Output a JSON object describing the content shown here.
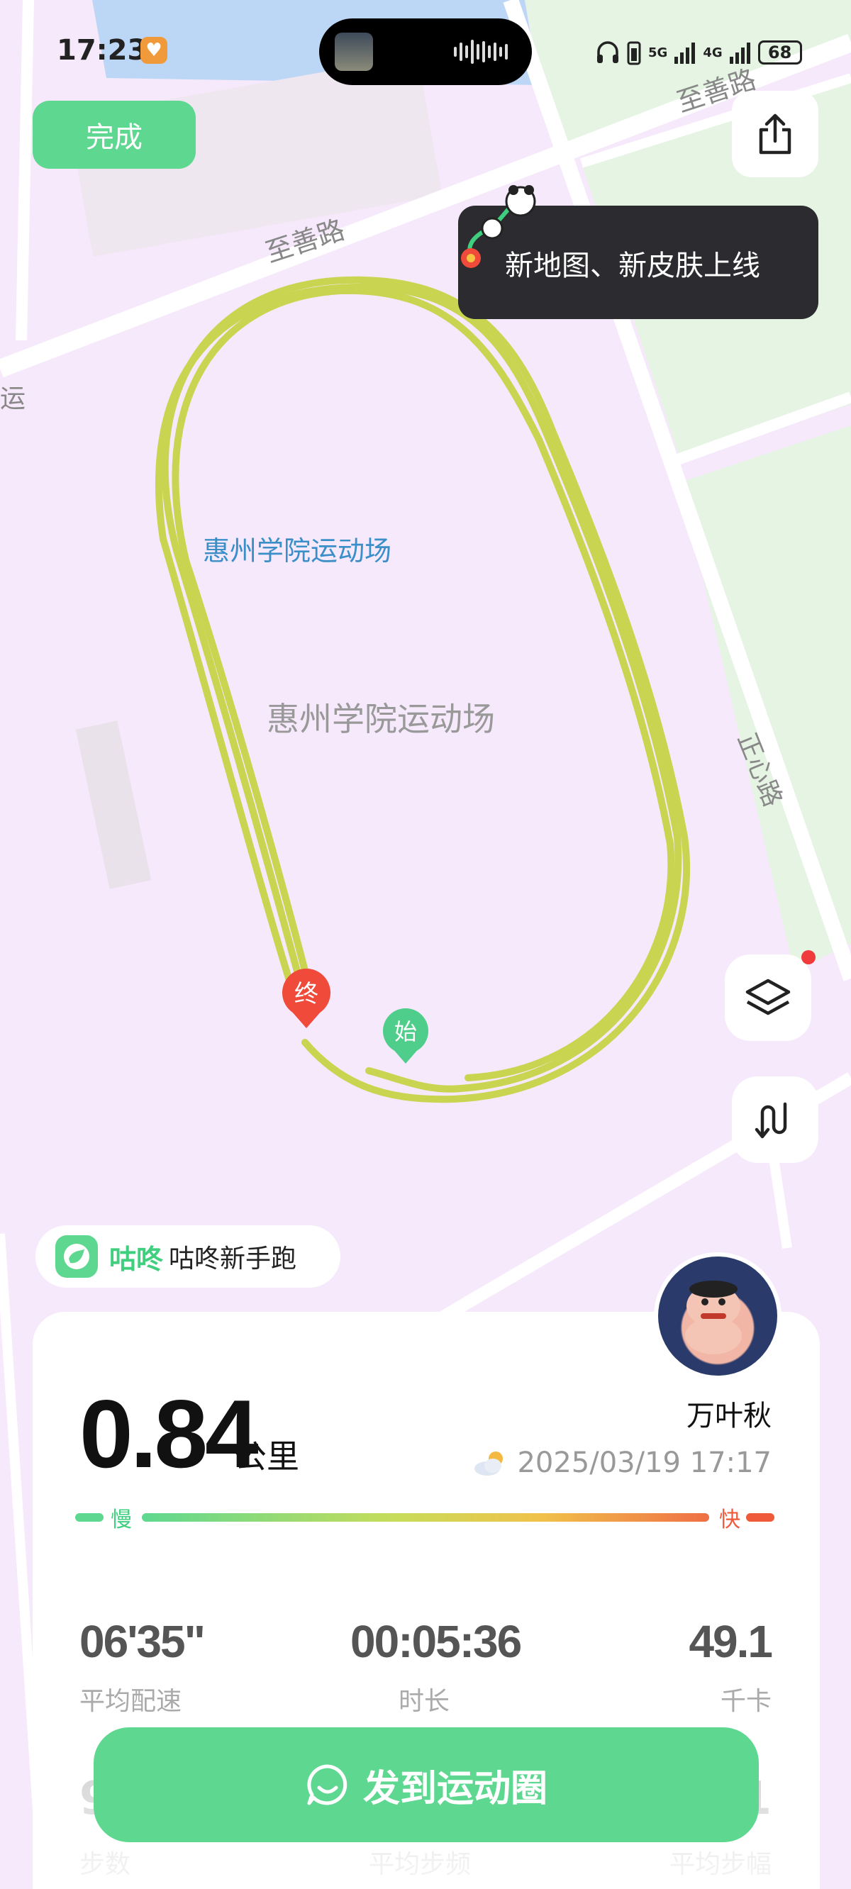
{
  "status_bar": {
    "time": "17:23",
    "battery": "68",
    "net1": "5G",
    "net2": "4G"
  },
  "toolbar": {
    "done_label": "完成"
  },
  "tooltip": {
    "text": "新地图、新皮肤上线"
  },
  "map": {
    "roads": [
      "至善路",
      "至善路",
      "正心路"
    ],
    "road_fragment": "运",
    "venue_label_blue": "惠州学院运动场",
    "venue_label_gray": "惠州学院运动场",
    "end_marker": "终",
    "start_marker": "始",
    "route_color": "#c9d451"
  },
  "tag": {
    "brand": "咕咚",
    "label": "咕咚新手跑"
  },
  "summary": {
    "distance": "0.84",
    "unit": "公里",
    "username": "万叶秋",
    "datetime": "2025/03/19 17:17",
    "pace_slow": "慢",
    "pace_fast": "快"
  },
  "stats": [
    {
      "value": "06'35\"",
      "label": "平均配速"
    },
    {
      "value": "00:05:36",
      "label": "时长"
    },
    {
      "value": "49.1",
      "label": "千卡"
    }
  ],
  "stats_row2": [
    {
      "value": "9",
      "label": "步数"
    },
    {
      "value": "",
      "label": "平均步频"
    },
    {
      "value": "1",
      "label": "平均步幅"
    }
  ],
  "cta": {
    "post_label": "发到运动圈"
  },
  "colors": {
    "accent": "#5ed890",
    "map_bg": "#f6e9fb",
    "park": "#e6f4e4"
  }
}
